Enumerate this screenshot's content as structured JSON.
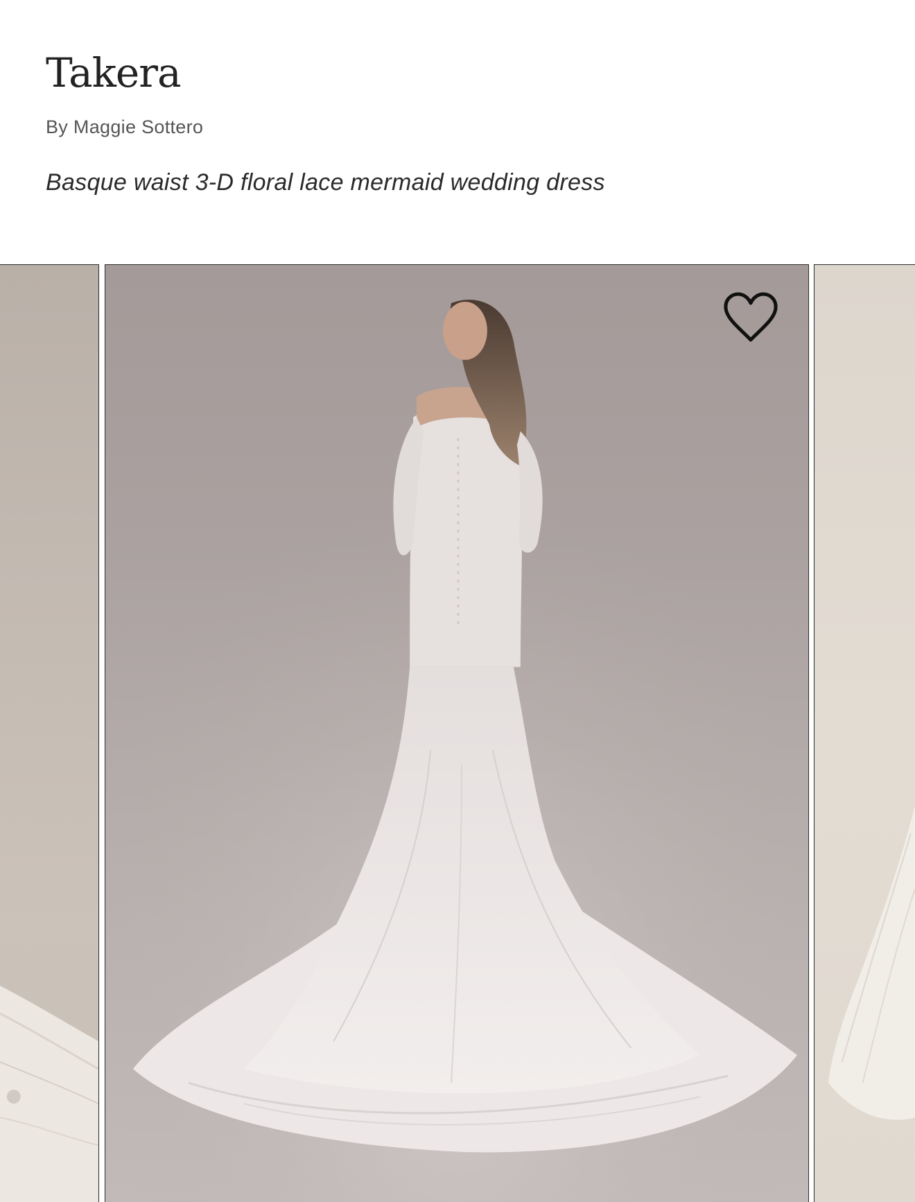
{
  "product": {
    "title": "Takera",
    "designer": "By Maggie Sottero",
    "description": "Basque waist 3-D floral lace mermaid wedding dress"
  },
  "gallery": {
    "favorite_icon": "heart-outline-icon",
    "slides": [
      {
        "position": "previous",
        "image": "wedding-dress-photo-partial"
      },
      {
        "position": "current",
        "image": "wedding-dress-back-view-photo"
      },
      {
        "position": "next",
        "image": "wedding-dress-photo-partial"
      }
    ]
  },
  "colors": {
    "background": "#ffffff",
    "text": "#222222",
    "muted_text": "#555555",
    "photo_backdrop": "#aaa1a0"
  }
}
